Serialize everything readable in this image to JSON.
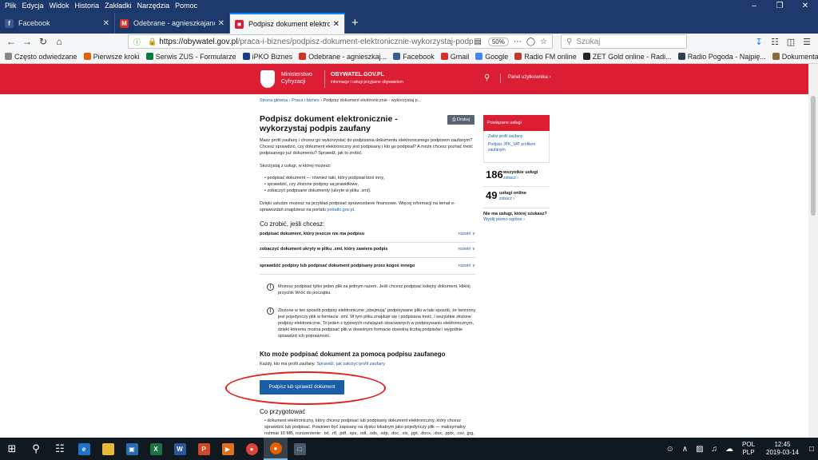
{
  "menu": [
    "Plik",
    "Edycja",
    "Widok",
    "Historia",
    "Zakładki",
    "Narzędzia",
    "Pomoc"
  ],
  "tabs": [
    {
      "title": "Facebook",
      "fav": "f",
      "color": "#3b5998"
    },
    {
      "title": "Odebrane - agnieszkajancza",
      "fav": "M",
      "color": "#d93025"
    },
    {
      "title": "Podpisz dokument elektroniczn",
      "fav": "■",
      "color": "#dc1e35"
    }
  ],
  "nav": {
    "url_host": "https://obywatel.gov.pl",
    "url_path": "/praca-i-biznes/podpisz-dokument-elektronicznie-wykorzystaj-podpis-",
    "zoom": "50%",
    "search_placeholder": "Szukaj"
  },
  "bookmarks": [
    {
      "label": "Często odwiedzane",
      "color": "#888"
    },
    {
      "label": "Pierwsze kroki",
      "color": "#e66000"
    },
    {
      "label": "Serwis ZUS - Formularze",
      "color": "#0a7a3e"
    },
    {
      "label": "iPKO Biznes",
      "color": "#1a3a8a"
    },
    {
      "label": "Odebrane - agnieszkaj...",
      "color": "#d93025"
    },
    {
      "label": "Facebook",
      "color": "#3b5998"
    },
    {
      "label": "Gmail",
      "color": "#d93025"
    },
    {
      "label": "Google",
      "color": "#4285f4"
    },
    {
      "label": "Radio FM online",
      "color": "#c0392b"
    },
    {
      "label": "ZET Gold online - Radi...",
      "color": "#222"
    },
    {
      "label": "Radio Pogoda - Najpię...",
      "color": "#2c3e50"
    },
    {
      "label": "Dokumentacja ODO - ...",
      "color": "#8a6d3b"
    }
  ],
  "header": {
    "ministry_1": "Ministerstwo",
    "ministry_2": "Cyfryzacji",
    "site": "OBYWATEL.GOV.PL",
    "site_sub": "informacje i usługi przyjazne obywatelom",
    "panel": "Panel użytkownika ›"
  },
  "breadcrumb": {
    "a": "Strona główna",
    "b": "Praca i biznes",
    "c": "Podpisz dokument elektronicznie - wykorzystaj p..."
  },
  "title": "Podpisz dokument elektronicznie - wykorzystaj podpis zaufany",
  "print": "Drukuj",
  "intro": "Masz profil zaufany i chcesz go wykorzystać do podpisania dokumentu elektronicznego podpisem zaufanym? Chcesz sprawdzić, czy dokument elektroniczny jest podpisany i kto go podpisał? A może chcesz poznać treść podpisanego już dokumentu? Sprawdź, jak to zrobić.",
  "usage_intro": "Skorzystaj z usługi, w której możesz:",
  "bullets": [
    "podpisać dokument — również taki, który podpisał ktoś inny,",
    "sprawdzić, czy złożone podpisy są prawidłowe,",
    "zobaczyć podpisane dokumenty (ukryte w pliku .xml)."
  ],
  "info_1": "Dzięki usłudze możesz na przykład podpisać sprawozdanie finansowe. Więcej informacji na temat e-sprawozdań znajdziesz na portalu",
  "info_link": "podatki.gov.pl",
  "how_title": "Co zrobić, jeśli chcesz:",
  "rows": [
    "podpisać dokument, który jeszcze nie ma podpisu",
    "zobaczyć dokument ukryty w pliku .xml, który zawiera podpis",
    "sprawdzić podpisy lub podpisać dokument podpisany przez kogoś innego"
  ],
  "expand": "rozwiń",
  "note_1": "Możesz podpisać tylko jeden plik za jednym razem. Jeśli chcesz podpisać kolejny dokument, kliknij przycisk Wróć do początku.",
  "note_2": "Złożone w ten sposób podpisy elektroniczne „obejmują” podpisywane pliki w taki sposób, że tworzony jest pojedynczy plik w formacie .xml. W tym pliku znajduje się i podpisana treść, i wszystkie złożone podpisy elektroniczne. To jeden z typowych rozwiązań stosowanych w podpisywaniu elektronicznym, dzięki któremu można podpisać plik w dowolnym formacie dowolną liczbą podpisów i wygodnie sprawdzić ich poprawność.",
  "who_title": "Kto może podpisać dokument za pomocą podpisu zaufanego",
  "who_text": "Każdy, kto ma profil zaufany.",
  "who_link": "Sprawdź, jak założyć profil zaufany",
  "cta": "Podpisz lub sprawdź dokument",
  "prepare_title": "Co przygotować",
  "prepare_text": "• dokument elektroniczny, który chcesz podpisać lub podpisany dokument elektroniczny, który chcesz sprawdzić lub podpisać. Powinien być zapisany na dysku lokalnym jako pojedynczy plik — maksymalny rozmiar 10 MB, rozszerzenie: .txt, .rtf, .pdf, .xps, .odt, .ods, .odp, .doc, .xls, .ppt, .docx, .xlsx, .pptx, .csv, .jpg,",
  "sidebar": {
    "head": "Powiązane usługi",
    "link_1": "Załóż profil zaufany",
    "link_2": "Podpisz JPK_VAT profilem zaufanym",
    "stat_1_n": "186",
    "stat_1_l": "wszystkie usługi",
    "stat_1_s": "zobacz ›",
    "stat_2_n": "49",
    "stat_2_l": "usługi online",
    "stat_2_s": "zobacz ›",
    "q": "Nie ma usługi, której szukasz?",
    "q_link": "Wyślij pismo ogólne ›"
  },
  "tray": {
    "lang_1": "POL",
    "lang_2": "PLP",
    "time": "12:45",
    "date": "2019-03-14"
  }
}
